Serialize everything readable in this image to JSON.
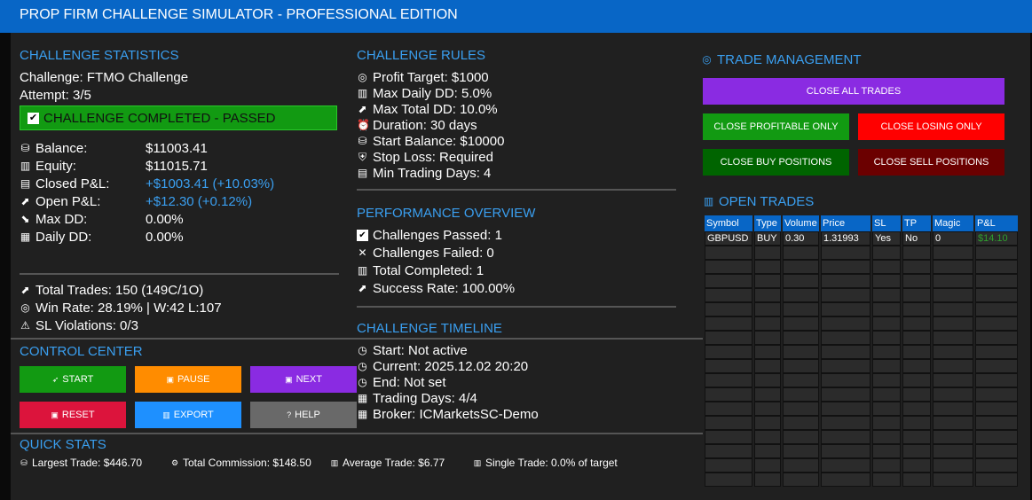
{
  "title": "PROP FIRM CHALLENGE SIMULATOR - PROFESSIONAL EDITION",
  "stats": {
    "heading": "CHALLENGE STATISTICS",
    "challenge": "Challenge: FTMO Challenge",
    "attempt": "Attempt: 3/5",
    "status_banner": "CHALLENGE COMPLETED - PASSED",
    "rows": [
      {
        "icon": "money-bag-icon",
        "label": "Balance:",
        "value": "$11003.41"
      },
      {
        "icon": "bar-chart-icon",
        "label": "Equity:",
        "value": "$11015.71"
      },
      {
        "icon": "ledger-icon",
        "label": "Closed P&L:",
        "value": "+$1003.41 (+10.03%)"
      },
      {
        "icon": "chart-up-icon",
        "label": "Open P&L:",
        "value": "+$12.30 (+0.12%)"
      },
      {
        "icon": "chart-down-icon",
        "label": "Max DD:",
        "value": "0.00%"
      },
      {
        "icon": "calendar-icon",
        "label": "Daily DD:",
        "value": "0.00%"
      }
    ],
    "total_trades": "Total Trades: 150 (149C/1O)",
    "win_rate": "Win Rate: 28.19% | W:42 L:107",
    "sl_violations": "SL Violations: 0/3"
  },
  "rules": {
    "heading": "CHALLENGE RULES",
    "items": [
      "Profit Target: $1000",
      "Max Daily DD: 5.0%",
      "Max Total DD: 10.0%",
      "Duration: 30 days",
      "Start Balance: $10000",
      "Stop Loss: Required",
      "Min Trading Days: 4"
    ]
  },
  "performance": {
    "heading": "PERFORMANCE OVERVIEW",
    "items": [
      "Challenges Passed: 1",
      "Challenges Failed: 0",
      "Total Completed: 1",
      "Success Rate: 100.00%"
    ]
  },
  "timeline": {
    "heading": "CHALLENGE TIMELINE",
    "items": [
      "Start: Not active",
      "Current: 2025.12.02 20:20",
      "End: Not set",
      "Trading Days: 4/4",
      "Broker: ICMarketsSC-Demo"
    ]
  },
  "control": {
    "heading": "CONTROL CENTER",
    "start": "START",
    "pause": "PAUSE",
    "next": "NEXT",
    "reset": "RESET",
    "export": "EXPORT",
    "help": "HELP"
  },
  "quick": {
    "heading": "QUICK STATS",
    "largest": "Largest Trade: $446.70",
    "commission": "Total Commission: $148.50",
    "average": "Average Trade: $6.77",
    "single": "Single Trade: 0.0% of target"
  },
  "trade_mgmt": {
    "heading": "TRADE MANAGEMENT",
    "close_all": "CLOSE ALL TRADES",
    "close_profitable": "CLOSE PROFITABLE ONLY",
    "close_losing": "CLOSE LOSING ONLY",
    "close_buy": "CLOSE BUY POSITIONS",
    "close_sell": "CLOSE SELL POSITIONS"
  },
  "open_trades": {
    "heading": "OPEN TRADES",
    "columns": [
      "Symbol",
      "Type",
      "Volume",
      "Price",
      "SL",
      "TP",
      "Magic",
      "P&L"
    ],
    "rows": [
      [
        "GBPUSD",
        "BUY",
        "0.30",
        "1.31993",
        "Yes",
        "No",
        "0",
        "$14.10"
      ]
    ],
    "empty_rows": 17
  },
  "colors": {
    "accent": "#3a9ff0",
    "titlebar": "#0866c6",
    "pass_green": "#129a12",
    "purple": "#8a2be2",
    "red": "#ff0000",
    "dark_red": "#6b0000",
    "orange": "#ff8c00",
    "crimson": "#dc143c",
    "blue": "#1e90ff",
    "gray": "#696969"
  }
}
